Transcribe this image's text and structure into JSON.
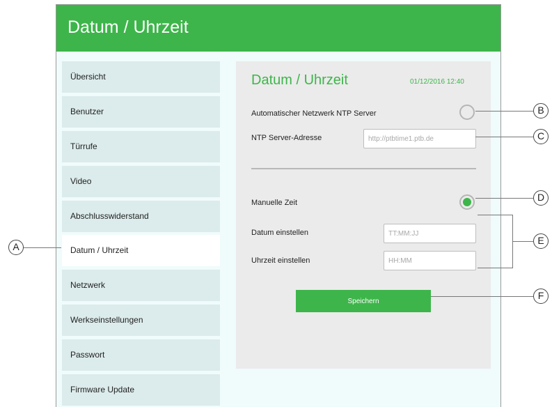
{
  "window": {
    "title": "Datum / Uhrzeit"
  },
  "sidebar": {
    "items": [
      {
        "label": "Übersicht"
      },
      {
        "label": "Benutzer"
      },
      {
        "label": "Türrufe"
      },
      {
        "label": "Video"
      },
      {
        "label": "Abschlusswiderstand"
      },
      {
        "label": "Datum / Uhrzeit",
        "active": true
      },
      {
        "label": "Netzwerk"
      },
      {
        "label": "Werkseinstellungen"
      },
      {
        "label": "Passwort"
      },
      {
        "label": "Firmware Update"
      }
    ]
  },
  "panel": {
    "title": "Datum / Uhrzeit",
    "datetime": "01/12/2016 12:40",
    "ntp_auto_label": "Automatischer Netzwerk NTP Server",
    "ntp_address_label": "NTP Server-Adresse",
    "ntp_address_placeholder": "http://ptbtime1.ptb.de",
    "manual_time_label": "Manuelle Zeit",
    "date_label": "Datum einstellen",
    "date_placeholder": "TT:MM:JJ",
    "time_label": "Uhrzeit einstellen",
    "time_placeholder": "HH:MM",
    "save_label": "Speichern",
    "ntp_auto_selected": false,
    "manual_time_selected": true
  },
  "callouts": {
    "a": "A",
    "b": "B",
    "c": "C",
    "d": "D",
    "e": "E",
    "f": "F"
  },
  "colors": {
    "accent": "#3db54a",
    "sidebar_bg": "#dcebeb",
    "panel_bg": "#ebebeb",
    "screen_bg": "#f0fbfb"
  }
}
